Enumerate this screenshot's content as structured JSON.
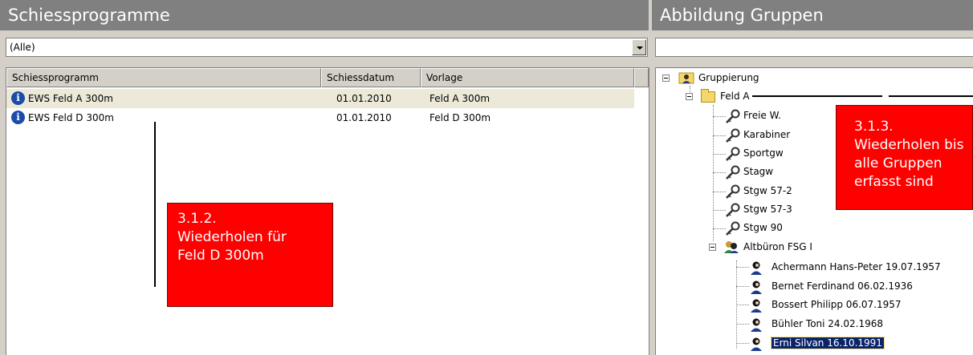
{
  "left_panel": {
    "title": "Schiessprogramme",
    "filter_value": "(Alle)",
    "columns": [
      "Schiessprogramm",
      "Schiessdatum",
      "Vorlage"
    ],
    "rows": [
      {
        "name": "EWS Feld A 300m",
        "date": "01.01.2010",
        "template": "Feld A 300m",
        "icon": "info-icon"
      },
      {
        "name": "EWS Feld D 300m",
        "date": "01.01.2010",
        "template": "Feld D 300m",
        "icon": "info-icon"
      }
    ]
  },
  "right_panel": {
    "title": "Abbildung Gruppen",
    "tree": {
      "root": "Gruppierung",
      "folder": "Feld A",
      "weapons": [
        "Freie W.",
        "Karabiner",
        "Sportgw",
        "Stagw",
        "Stgw 57-2",
        "Stgw 57-3",
        "Stgw 90"
      ],
      "group": "Altbüron FSG I",
      "members": [
        "Achermann Hans-Peter 19.07.1957",
        "Bernet Ferdinand 06.02.1936",
        "Bossert Philipp 06.07.1957",
        "Bühler Toni 24.02.1968",
        "Erni Silvan 16.10.1991"
      ],
      "selected_member": "Erni Silvan 16.10.1991"
    }
  },
  "notes": {
    "left": [
      "3.1.2.",
      "Wiederholen für",
      "Feld D 300m"
    ],
    "right": [
      "3.1.3.",
      "Wiederholen bis",
      "alle Gruppen",
      "erfasst sind"
    ]
  },
  "colors": {
    "title_bg": "#808080",
    "note_bg": "#ff0000",
    "selection": "#0a246a",
    "selected_row": "#ece9d8"
  }
}
